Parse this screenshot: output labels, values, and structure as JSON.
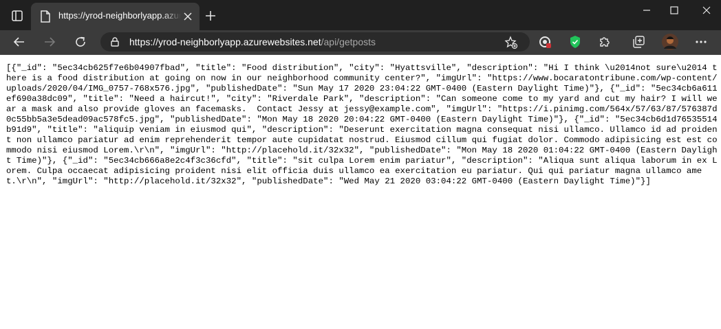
{
  "tab": {
    "title": "https://yrod-neighborlyapp.azurewebsites.net/api/getposts"
  },
  "address_bar": {
    "host": "https://yrod-neighborlyapp.azurewebsites.net",
    "path": "/api/getposts"
  },
  "icons": {
    "tab_actions": "tab-actions-icon",
    "favicon": "page-favicon-icon",
    "tab_close": "close-icon",
    "new_tab": "plus-icon",
    "minimize": "minimize-icon",
    "maximize": "maximize-icon",
    "window_close": "close-icon",
    "back": "back-arrow-icon",
    "forward": "forward-arrow-icon",
    "refresh": "refresh-icon",
    "lock": "lock-icon",
    "favorite": "star-add-icon",
    "ext1": "extension-badge-icon",
    "ext2": "shield-icon",
    "extensions": "puzzle-icon",
    "collections": "collections-icon",
    "more": "more-icon"
  },
  "colors": {
    "titlebar": "#202020",
    "toolbar": "#3b3b3b",
    "shield": "#21c35a"
  },
  "body": {
    "text": "[{\"_id\": \"5ec34cb625f7e6b04907fbad\", \"title\": \"Food distribution\", \"city\": \"Hyattsville\", \"description\": \"Hi I think \\u2014not sure\\u2014 there is a food distribution at going on now in our neighborhood community center?\", \"imgUrl\": \"https://www.bocaratontribune.com/wp-content/uploads/2020/04/IMG_0757-768x576.jpg\", \"publishedDate\": \"Sun May 17 2020 23:04:22 GMT-0400 (Eastern Daylight Time)\"}, {\"_id\": \"5ec34cb6a611ef690a38dc09\", \"title\": \"Need a haircut!\", \"city\": \"Riverdale Park\", \"description\": \"Can someone come to my yard and cut my hair? I will wear a mask and also provide gloves an facemasks.  Contact Jessy at jessy@example.com\", \"imgUrl\": \"https://i.pinimg.com/564x/57/63/87/576387d0c55bb5a3e5dead09ac578fc5.jpg\", \"publishedDate\": \"Mon May 18 2020 20:04:22 GMT-0400 (Eastern Daylight Time)\"}, {\"_id\": \"5ec34cb6d1d76535514b91d9\", \"title\": \"aliquip veniam in eiusmod qui\", \"description\": \"Deserunt exercitation magna consequat nisi ullamco. Ullamco id ad proident non ullamco pariatur ad enim reprehenderit tempor aute cupidatat nostrud. Eiusmod cillum qui fugiat dolor. Commodo adipisicing est est commodo nisi eiusmod Lorem.\\r\\n\", \"imgUrl\": \"http://placehold.it/32x32\", \"publishedDate\": \"Mon May 18 2020 01:04:22 GMT-0400 (Eastern Daylight Time)\"}, {\"_id\": \"5ec34cb666a8e2c4f3c36cfd\", \"title\": \"sit culpa Lorem enim pariatur\", \"description\": \"Aliqua sunt aliqua laborum in ex Lorem. Culpa occaecat adipisicing proident nisi elit officia duis ullamco ea exercitation eu pariatur. Qui qui pariatur magna ullamco amet.\\r\\n\", \"imgUrl\": \"http://placehold.it/32x32\", \"publishedDate\": \"Wed May 21 2020 03:04:22 GMT-0400 (Eastern Daylight Time)\"}]"
  }
}
